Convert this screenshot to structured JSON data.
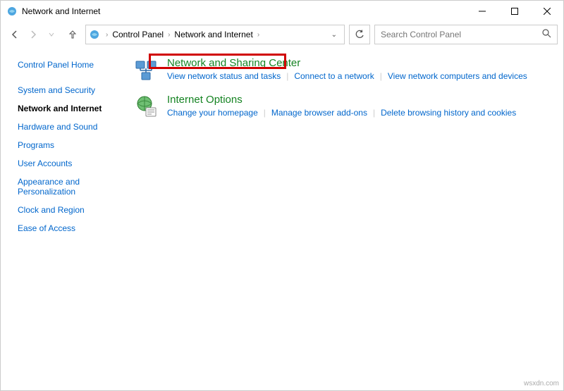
{
  "titlebar": {
    "title": "Network and Internet"
  },
  "breadcrumb": {
    "item1": "Control Panel",
    "item2": "Network and Internet"
  },
  "search": {
    "placeholder": "Search Control Panel"
  },
  "sidebar": {
    "home": "Control Panel Home",
    "items": [
      "System and Security",
      "Network and Internet",
      "Hardware and Sound",
      "Programs",
      "User Accounts",
      "Appearance and Personalization",
      "Clock and Region",
      "Ease of Access"
    ]
  },
  "categories": [
    {
      "title": "Network and Sharing Center",
      "links": [
        "View network status and tasks",
        "Connect to a network",
        "View network computers and devices"
      ]
    },
    {
      "title": "Internet Options",
      "links": [
        "Change your homepage",
        "Manage browser add-ons",
        "Delete browsing history and cookies"
      ]
    }
  ],
  "watermark": "wsxdn.com"
}
